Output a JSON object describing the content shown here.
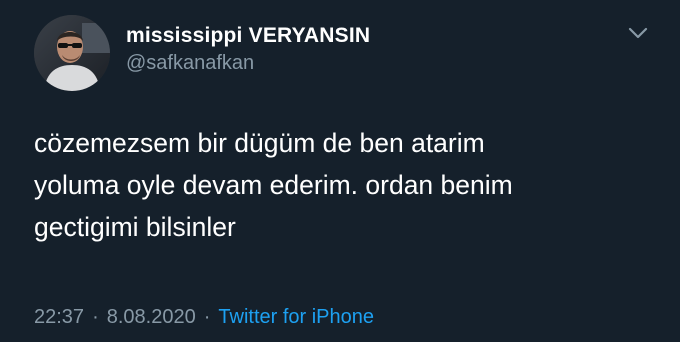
{
  "user": {
    "display_name": "mississippi VERYANSIN",
    "handle": "@safkanafkan"
  },
  "tweet": {
    "lines": [
      "cözemezsem bir dügüm de ben atarim",
      "yoluma oyle devam ederim. ordan benim",
      "gectigimi bilsinler"
    ],
    "time": "22:37",
    "separator": "·",
    "date": "8.08.2020",
    "source": "Twitter for iPhone"
  },
  "icons": {
    "menu": "chevron-down-icon",
    "avatar": "avatar"
  },
  "colors": {
    "background": "#15202b",
    "primary_text": "#ffffff",
    "secondary_text": "#8899a6",
    "link": "#1da1f2"
  }
}
